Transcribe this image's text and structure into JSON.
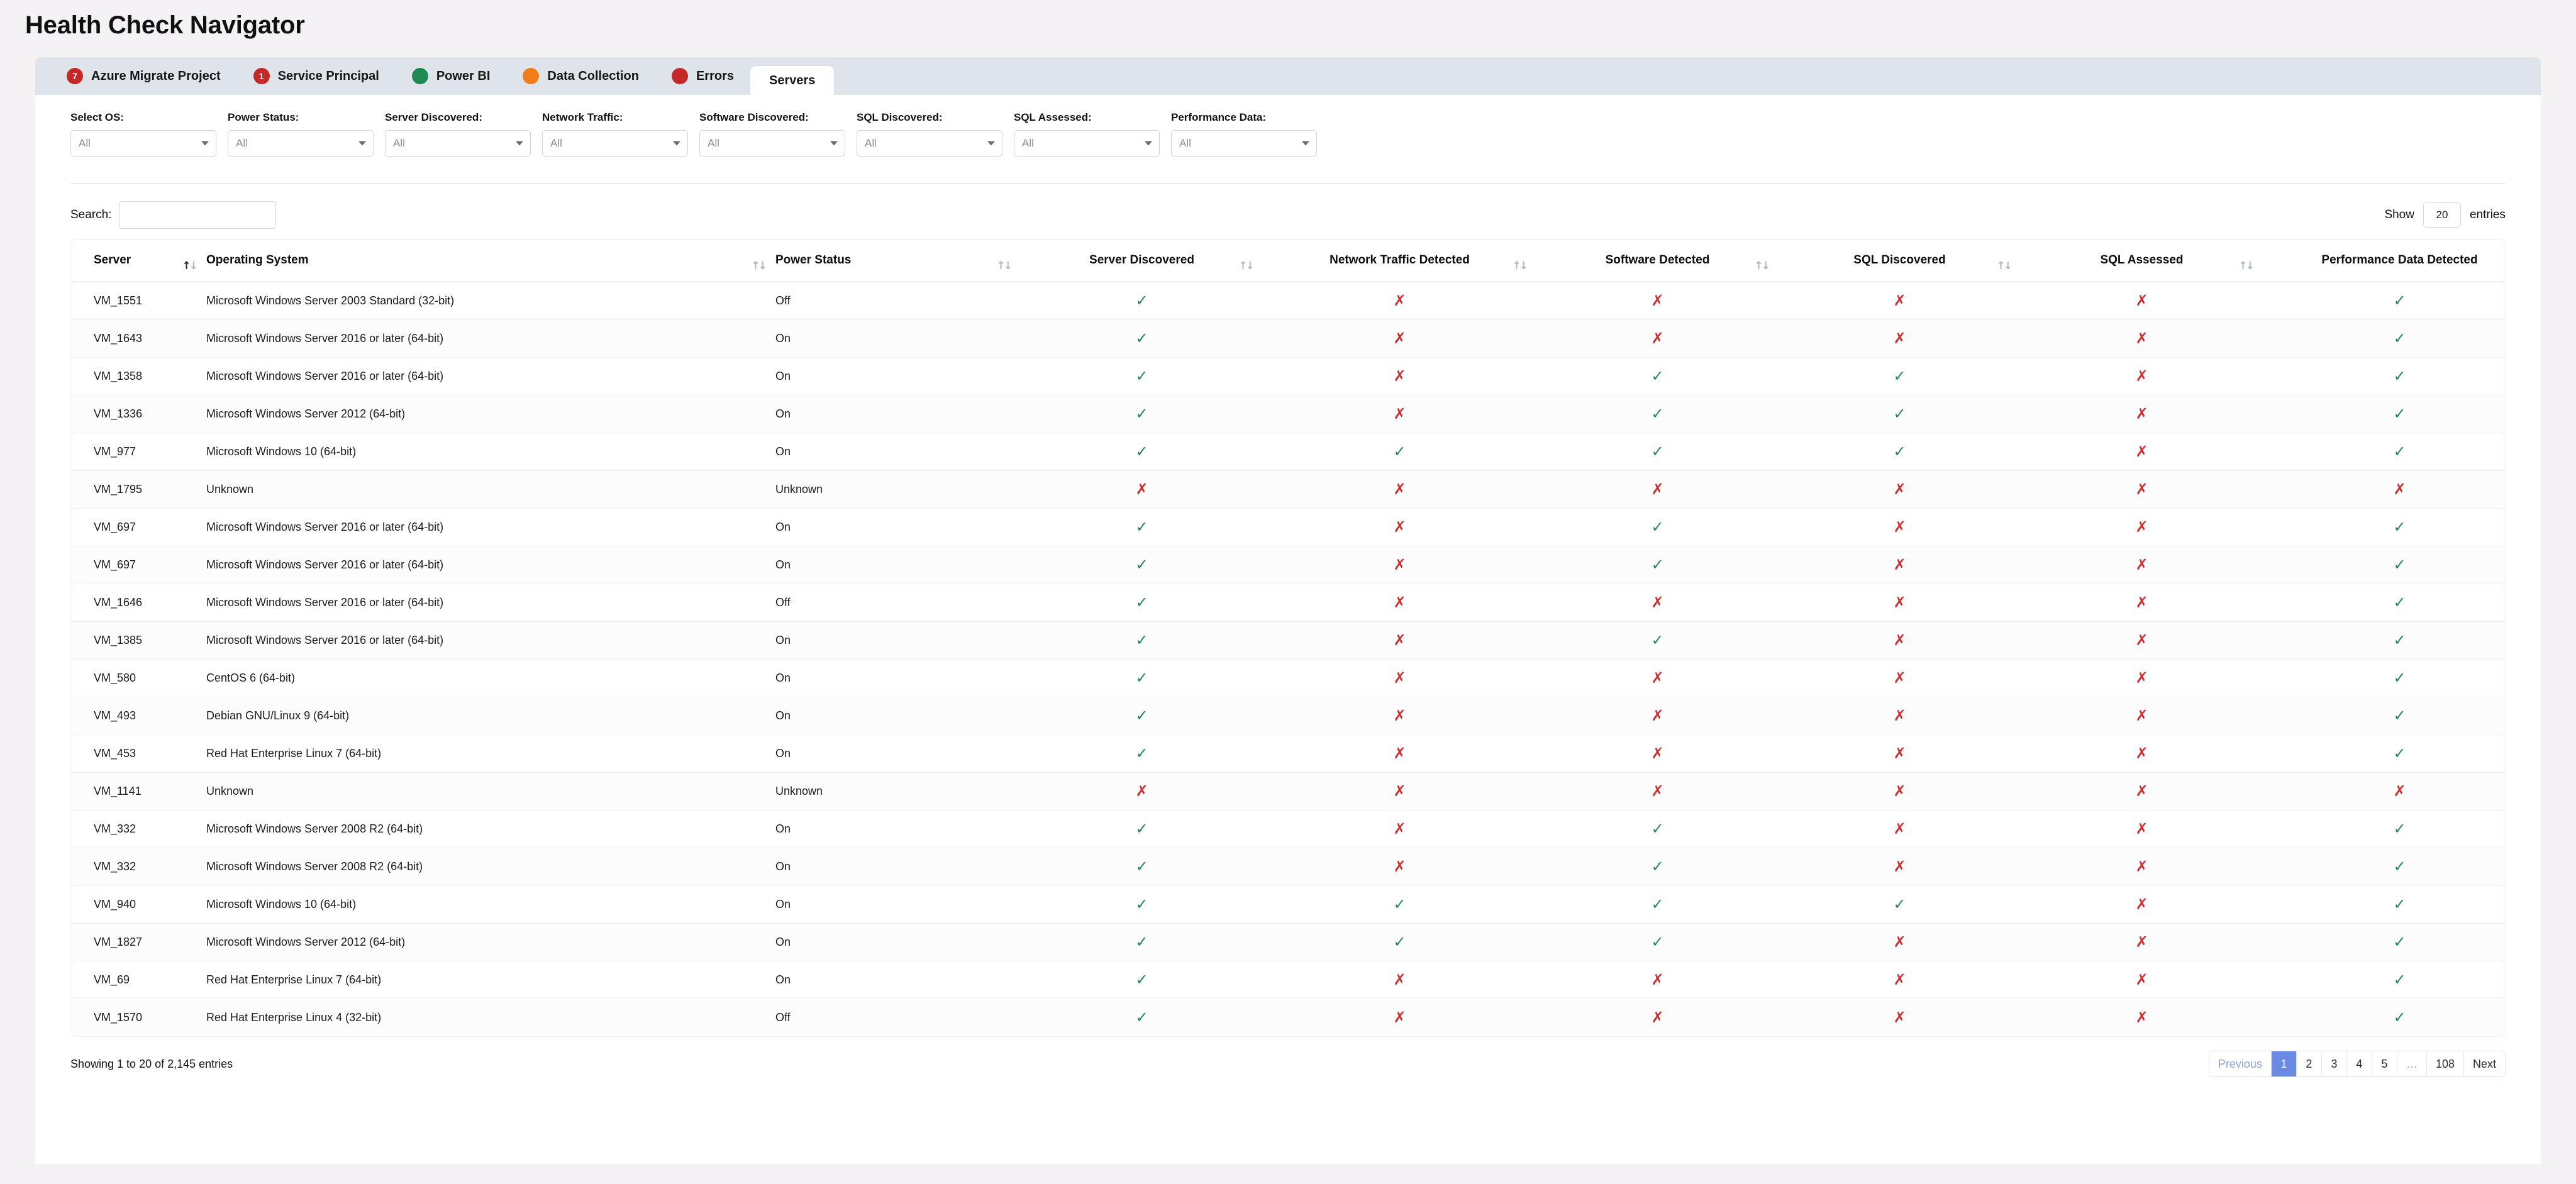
{
  "app": {
    "title": "Health Check Navigator"
  },
  "tabs": [
    {
      "label": "Azure Migrate Project",
      "badge": "7",
      "color": "#c62828",
      "active": false
    },
    {
      "label": "Service Principal",
      "badge": "1",
      "color": "#c62828",
      "active": false
    },
    {
      "label": "Power BI",
      "badge": "",
      "color": "#1d8a54",
      "active": false
    },
    {
      "label": "Data Collection",
      "badge": "",
      "color": "#ef7d1a",
      "active": false
    },
    {
      "label": "Errors",
      "badge": "",
      "color": "#c62828",
      "active": false
    },
    {
      "label": "Servers",
      "badge": "",
      "color": "",
      "active": true
    }
  ],
  "filters": [
    {
      "label": "Select OS:",
      "value": "All"
    },
    {
      "label": "Power Status:",
      "value": "All"
    },
    {
      "label": "Server Discovered:",
      "value": "All"
    },
    {
      "label": "Network Traffic:",
      "value": "All"
    },
    {
      "label": "Software Discovered:",
      "value": "All"
    },
    {
      "label": "SQL Discovered:",
      "value": "All"
    },
    {
      "label": "SQL Assessed:",
      "value": "All"
    },
    {
      "label": "Performance Data:",
      "value": "All"
    }
  ],
  "toolbar": {
    "search_label": "Search:",
    "search_value": "",
    "search_placeholder": "",
    "show_label": "Show",
    "entries_value": "20",
    "entries_label": "entries"
  },
  "table": {
    "columns": [
      "Server",
      "Operating System",
      "Power Status",
      "Server Discovered",
      "Network Traffic Detected",
      "Software Detected",
      "SQL Discovered",
      "SQL Assessed",
      "Performance Data Detected"
    ],
    "sorted_column_index": 0,
    "rows": [
      {
        "server": "VM_1551",
        "os": "Microsoft Windows Server 2003 Standard (32-bit)",
        "power": "Off",
        "server_discovered": true,
        "network_traffic": false,
        "software": false,
        "sql_discovered": false,
        "sql_assessed": false,
        "performance": true
      },
      {
        "server": "VM_1643",
        "os": "Microsoft Windows Server 2016 or later (64-bit)",
        "power": "On",
        "server_discovered": true,
        "network_traffic": false,
        "software": false,
        "sql_discovered": false,
        "sql_assessed": false,
        "performance": true
      },
      {
        "server": "VM_1358",
        "os": "Microsoft Windows Server 2016 or later (64-bit)",
        "power": "On",
        "server_discovered": true,
        "network_traffic": false,
        "software": true,
        "sql_discovered": true,
        "sql_assessed": false,
        "performance": true
      },
      {
        "server": "VM_1336",
        "os": "Microsoft Windows Server 2012 (64-bit)",
        "power": "On",
        "server_discovered": true,
        "network_traffic": false,
        "software": true,
        "sql_discovered": true,
        "sql_assessed": false,
        "performance": true
      },
      {
        "server": "VM_977",
        "os": "Microsoft Windows 10 (64-bit)",
        "power": "On",
        "server_discovered": true,
        "network_traffic": true,
        "software": true,
        "sql_discovered": true,
        "sql_assessed": false,
        "performance": true
      },
      {
        "server": "VM_1795",
        "os": "Unknown",
        "power": "Unknown",
        "server_discovered": false,
        "network_traffic": false,
        "software": false,
        "sql_discovered": false,
        "sql_assessed": false,
        "performance": false
      },
      {
        "server": "VM_697",
        "os": "Microsoft Windows Server 2016 or later (64-bit)",
        "power": "On",
        "server_discovered": true,
        "network_traffic": false,
        "software": true,
        "sql_discovered": false,
        "sql_assessed": false,
        "performance": true
      },
      {
        "server": "VM_697",
        "os": "Microsoft Windows Server 2016 or later (64-bit)",
        "power": "On",
        "server_discovered": true,
        "network_traffic": false,
        "software": true,
        "sql_discovered": false,
        "sql_assessed": false,
        "performance": true
      },
      {
        "server": "VM_1646",
        "os": "Microsoft Windows Server 2016 or later (64-bit)",
        "power": "Off",
        "server_discovered": true,
        "network_traffic": false,
        "software": false,
        "sql_discovered": false,
        "sql_assessed": false,
        "performance": true
      },
      {
        "server": "VM_1385",
        "os": "Microsoft Windows Server 2016 or later (64-bit)",
        "power": "On",
        "server_discovered": true,
        "network_traffic": false,
        "software": true,
        "sql_discovered": false,
        "sql_assessed": false,
        "performance": true
      },
      {
        "server": "VM_580",
        "os": "CentOS 6 (64-bit)",
        "power": "On",
        "server_discovered": true,
        "network_traffic": false,
        "software": false,
        "sql_discovered": false,
        "sql_assessed": false,
        "performance": true
      },
      {
        "server": "VM_493",
        "os": "Debian GNU/Linux 9 (64-bit)",
        "power": "On",
        "server_discovered": true,
        "network_traffic": false,
        "software": false,
        "sql_discovered": false,
        "sql_assessed": false,
        "performance": true
      },
      {
        "server": "VM_453",
        "os": "Red Hat Enterprise Linux 7 (64-bit)",
        "power": "On",
        "server_discovered": true,
        "network_traffic": false,
        "software": false,
        "sql_discovered": false,
        "sql_assessed": false,
        "performance": true
      },
      {
        "server": "VM_1141",
        "os": "Unknown",
        "power": "Unknown",
        "server_discovered": false,
        "network_traffic": false,
        "software": false,
        "sql_discovered": false,
        "sql_assessed": false,
        "performance": false
      },
      {
        "server": "VM_332",
        "os": "Microsoft Windows Server 2008 R2 (64-bit)",
        "power": "On",
        "server_discovered": true,
        "network_traffic": false,
        "software": true,
        "sql_discovered": false,
        "sql_assessed": false,
        "performance": true
      },
      {
        "server": "VM_332",
        "os": "Microsoft Windows Server 2008 R2 (64-bit)",
        "power": "On",
        "server_discovered": true,
        "network_traffic": false,
        "software": true,
        "sql_discovered": false,
        "sql_assessed": false,
        "performance": true
      },
      {
        "server": "VM_940",
        "os": "Microsoft Windows 10 (64-bit)",
        "power": "On",
        "server_discovered": true,
        "network_traffic": true,
        "software": true,
        "sql_discovered": true,
        "sql_assessed": false,
        "performance": true
      },
      {
        "server": "VM_1827",
        "os": "Microsoft Windows Server 2012 (64-bit)",
        "power": "On",
        "server_discovered": true,
        "network_traffic": true,
        "software": true,
        "sql_discovered": false,
        "sql_assessed": false,
        "performance": true
      },
      {
        "server": "VM_69",
        "os": "Red Hat Enterprise Linux 7 (64-bit)",
        "power": "On",
        "server_discovered": true,
        "network_traffic": false,
        "software": false,
        "sql_discovered": false,
        "sql_assessed": false,
        "performance": true
      },
      {
        "server": "VM_1570",
        "os": "Red Hat Enterprise Linux 4 (32-bit)",
        "power": "Off",
        "server_discovered": true,
        "network_traffic": false,
        "software": false,
        "sql_discovered": false,
        "sql_assessed": false,
        "performance": true
      }
    ],
    "mark_yes": "✓",
    "mark_no": "✗"
  },
  "footer": {
    "showing": "Showing 1 to 20 of 2,145 entries",
    "pagination": [
      {
        "label": "Previous",
        "state": "muted"
      },
      {
        "label": "1",
        "state": "active"
      },
      {
        "label": "2",
        "state": "normal"
      },
      {
        "label": "3",
        "state": "normal"
      },
      {
        "label": "4",
        "state": "normal"
      },
      {
        "label": "5",
        "state": "normal"
      },
      {
        "label": "…",
        "state": "ellipsis"
      },
      {
        "label": "108",
        "state": "normal"
      },
      {
        "label": "Next",
        "state": "normal"
      }
    ]
  },
  "colors": {
    "accent": "#6b8ae4",
    "yes": "#238a54",
    "no": "#cf2d2d",
    "tabbar": "#dfe4ea",
    "page_bg": "#f4f2f4"
  }
}
